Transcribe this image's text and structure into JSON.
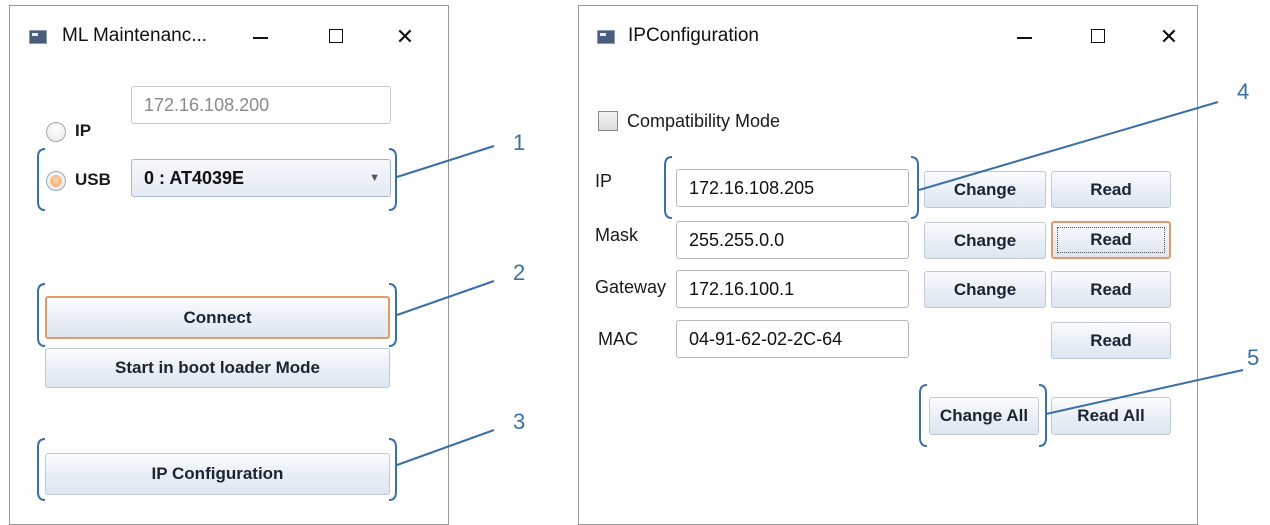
{
  "left_window": {
    "title": "ML Maintenanc...",
    "ip_radio_label": "IP",
    "ip_value": "172.16.108.200",
    "usb_radio_label": "USB",
    "usb_selected": "0 : AT4039E",
    "connect_label": "Connect",
    "boot_label": "Start in boot loader Mode",
    "ipconfig_label": "IP Configuration"
  },
  "right_window": {
    "title": "IPConfiguration",
    "compat_label": "Compatibility Mode",
    "rows": [
      {
        "label": "IP",
        "value": "172.16.108.205",
        "change": "Change",
        "read": "Read"
      },
      {
        "label": "Mask",
        "value": "255.255.0.0",
        "change": "Change",
        "read": "Read"
      },
      {
        "label": "Gateway",
        "value": "172.16.100.1",
        "change": "Change",
        "read": "Read"
      },
      {
        "label": "MAC",
        "value": "04-91-62-02-2C-64",
        "read": "Read"
      }
    ],
    "change_all_label": "Change All",
    "read_all_label": "Read All"
  },
  "callouts": [
    "1",
    "2",
    "3",
    "4",
    "5"
  ],
  "colors": {
    "callout": "#3a6fa8",
    "focus": "#e39a6a",
    "button_top": "#fbfcfe",
    "button_bottom": "#dde6f1"
  }
}
